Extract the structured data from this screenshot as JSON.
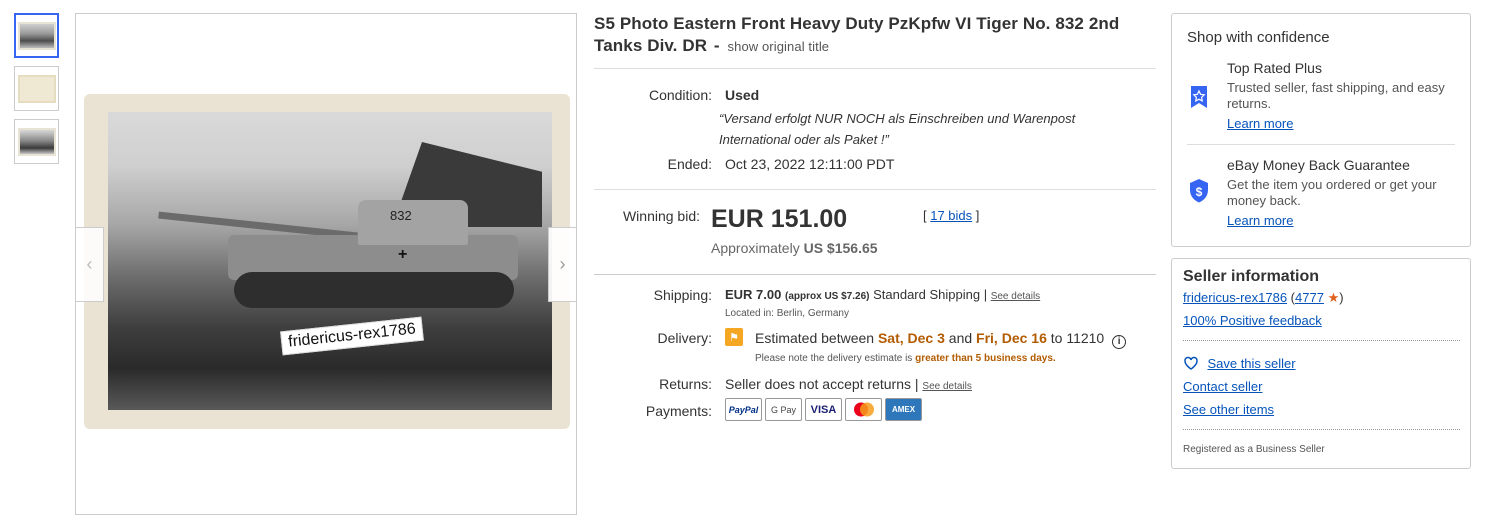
{
  "title": {
    "text": "S5 Photo Eastern Front Heavy Duty PzKpfw VI Tiger No. 832 2nd Tanks Div. DR",
    "separator": "-",
    "original_link": "show original title"
  },
  "image": {
    "tank_number": "832",
    "watermark": "fridericus-rex1786"
  },
  "condition": {
    "label": "Condition:",
    "value": "Used",
    "note": "“Versand erfolgt NUR NOCH als Einschreiben und Warenpost International oder als Paket !”"
  },
  "ended": {
    "label": "Ended:",
    "value": "Oct 23, 2022 12:11:00 PDT"
  },
  "bid": {
    "label": "Winning bid:",
    "price": "EUR 151.00",
    "bids": "17 bids",
    "approx_prefix": "Approximately",
    "approx_value": "US $156.65"
  },
  "shipping": {
    "label": "Shipping:",
    "cost": "EUR 7.00",
    "approx": "(approx US $7.26)",
    "method": "Standard Shipping",
    "details_link": "See details",
    "location": "Located in: Berlin, Germany"
  },
  "delivery": {
    "label": "Delivery:",
    "prefix": "Estimated between",
    "date1": "Sat, Dec 3",
    "and": "and",
    "date2": "Fri, Dec 16",
    "to": "to 11210",
    "note_prefix": "Please note the delivery estimate is",
    "note_highlight": "greater than 5 business days."
  },
  "returns": {
    "label": "Returns:",
    "value": "Seller does not accept returns",
    "details_link": "See details"
  },
  "payments": {
    "label": "Payments:",
    "methods": [
      "PayPal",
      "G Pay",
      "VISA",
      "Mastercard",
      "AMEX"
    ]
  },
  "confidence": {
    "heading": "Shop with confidence",
    "items": [
      {
        "title": "Top Rated Plus",
        "desc": "Trusted seller, fast shipping, and easy returns.",
        "link": "Learn more"
      },
      {
        "title": "eBay Money Back Guarantee",
        "desc": "Get the item you ordered or get your money back.",
        "link": "Learn more"
      }
    ]
  },
  "seller": {
    "heading": "Seller information",
    "name": "fridericus-rex1786",
    "feedback_count": "4777",
    "positive": "100% Positive feedback",
    "save": "Save this seller",
    "contact": "Contact seller",
    "other": "See other items",
    "registered": "Registered as a Business Seller"
  },
  "colors": {
    "link": "#0654ba",
    "accent": "#3665f3",
    "orange": "#b35b00",
    "star": "#e0601a"
  }
}
